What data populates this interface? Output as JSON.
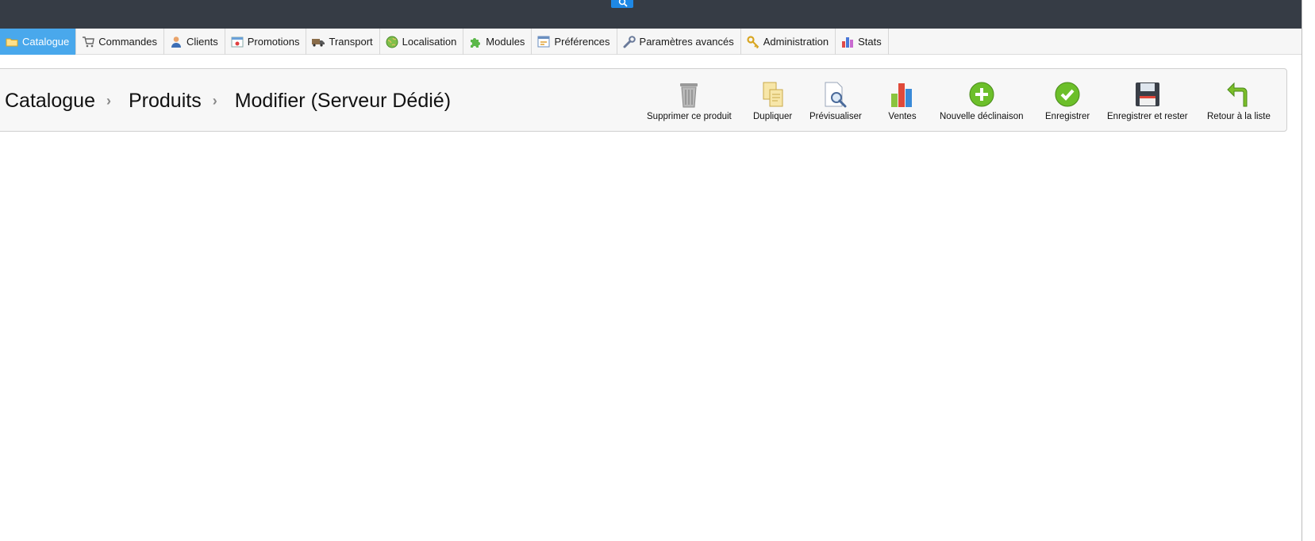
{
  "topbar": {
    "search_icon": "search-icon"
  },
  "tabs": [
    {
      "label": "Catalogue",
      "icon": "folder-icon",
      "active": true
    },
    {
      "label": "Commandes",
      "icon": "cart-icon"
    },
    {
      "label": "Clients",
      "icon": "user-icon"
    },
    {
      "label": "Promotions",
      "icon": "promo-icon"
    },
    {
      "label": "Transport",
      "icon": "truck-icon"
    },
    {
      "label": "Localisation",
      "icon": "globe-icon"
    },
    {
      "label": "Modules",
      "icon": "puzzle-icon"
    },
    {
      "label": "Préférences",
      "icon": "preferences-icon"
    },
    {
      "label": "Paramètres avancés",
      "icon": "wrench-icon"
    },
    {
      "label": "Administration",
      "icon": "key-icon"
    },
    {
      "label": "Stats",
      "icon": "stats-icon"
    }
  ],
  "breadcrumb": {
    "level1": "Catalogue",
    "level2": "Produits",
    "level3": "Modifier (Serveur Dédié)"
  },
  "actions": [
    {
      "label": "Supprimer ce produit",
      "icon": "trash-icon"
    },
    {
      "label": "Dupliquer",
      "icon": "duplicate-icon"
    },
    {
      "label": "Prévisualiser",
      "icon": "preview-icon"
    },
    {
      "label": "Ventes",
      "icon": "sales-chart-icon"
    },
    {
      "label": "Nouvelle déclinaison",
      "icon": "add-icon"
    },
    {
      "label": "Enregistrer",
      "icon": "check-icon"
    },
    {
      "label": "Enregistrer et rester",
      "icon": "floppy-icon"
    },
    {
      "label": "Retour à la liste",
      "icon": "back-arrow-icon"
    }
  ],
  "colors": {
    "topbar": "#363c45",
    "active_tab": "#49a8ec",
    "search": "#1e88e5"
  }
}
